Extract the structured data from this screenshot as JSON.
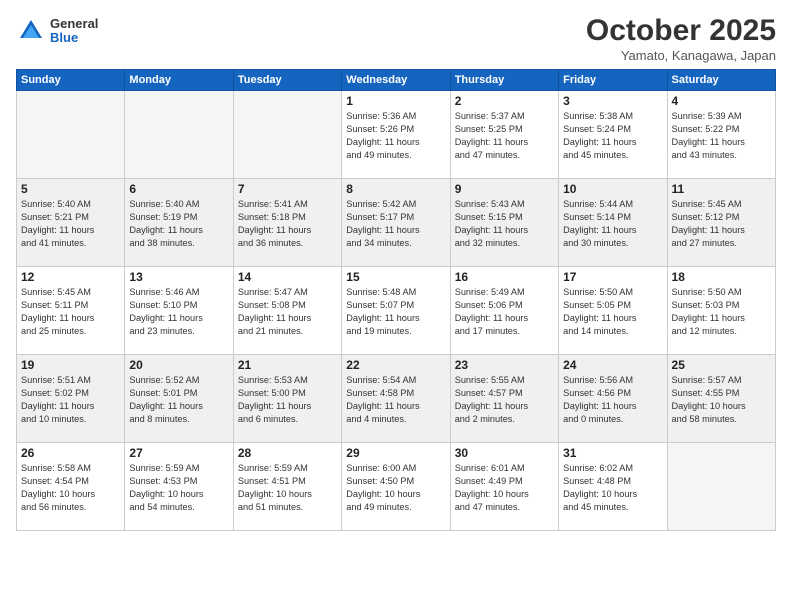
{
  "logo": {
    "general": "General",
    "blue": "Blue"
  },
  "title": "October 2025",
  "location": "Yamato, Kanagawa, Japan",
  "days_of_week": [
    "Sunday",
    "Monday",
    "Tuesday",
    "Wednesday",
    "Thursday",
    "Friday",
    "Saturday"
  ],
  "weeks": [
    {
      "shaded": false,
      "days": [
        {
          "date": "",
          "info": ""
        },
        {
          "date": "",
          "info": ""
        },
        {
          "date": "",
          "info": ""
        },
        {
          "date": "1",
          "info": "Sunrise: 5:36 AM\nSunset: 5:26 PM\nDaylight: 11 hours\nand 49 minutes."
        },
        {
          "date": "2",
          "info": "Sunrise: 5:37 AM\nSunset: 5:25 PM\nDaylight: 11 hours\nand 47 minutes."
        },
        {
          "date": "3",
          "info": "Sunrise: 5:38 AM\nSunset: 5:24 PM\nDaylight: 11 hours\nand 45 minutes."
        },
        {
          "date": "4",
          "info": "Sunrise: 5:39 AM\nSunset: 5:22 PM\nDaylight: 11 hours\nand 43 minutes."
        }
      ]
    },
    {
      "shaded": true,
      "days": [
        {
          "date": "5",
          "info": "Sunrise: 5:40 AM\nSunset: 5:21 PM\nDaylight: 11 hours\nand 41 minutes."
        },
        {
          "date": "6",
          "info": "Sunrise: 5:40 AM\nSunset: 5:19 PM\nDaylight: 11 hours\nand 38 minutes."
        },
        {
          "date": "7",
          "info": "Sunrise: 5:41 AM\nSunset: 5:18 PM\nDaylight: 11 hours\nand 36 minutes."
        },
        {
          "date": "8",
          "info": "Sunrise: 5:42 AM\nSunset: 5:17 PM\nDaylight: 11 hours\nand 34 minutes."
        },
        {
          "date": "9",
          "info": "Sunrise: 5:43 AM\nSunset: 5:15 PM\nDaylight: 11 hours\nand 32 minutes."
        },
        {
          "date": "10",
          "info": "Sunrise: 5:44 AM\nSunset: 5:14 PM\nDaylight: 11 hours\nand 30 minutes."
        },
        {
          "date": "11",
          "info": "Sunrise: 5:45 AM\nSunset: 5:12 PM\nDaylight: 11 hours\nand 27 minutes."
        }
      ]
    },
    {
      "shaded": false,
      "days": [
        {
          "date": "12",
          "info": "Sunrise: 5:45 AM\nSunset: 5:11 PM\nDaylight: 11 hours\nand 25 minutes."
        },
        {
          "date": "13",
          "info": "Sunrise: 5:46 AM\nSunset: 5:10 PM\nDaylight: 11 hours\nand 23 minutes."
        },
        {
          "date": "14",
          "info": "Sunrise: 5:47 AM\nSunset: 5:08 PM\nDaylight: 11 hours\nand 21 minutes."
        },
        {
          "date": "15",
          "info": "Sunrise: 5:48 AM\nSunset: 5:07 PM\nDaylight: 11 hours\nand 19 minutes."
        },
        {
          "date": "16",
          "info": "Sunrise: 5:49 AM\nSunset: 5:06 PM\nDaylight: 11 hours\nand 17 minutes."
        },
        {
          "date": "17",
          "info": "Sunrise: 5:50 AM\nSunset: 5:05 PM\nDaylight: 11 hours\nand 14 minutes."
        },
        {
          "date": "18",
          "info": "Sunrise: 5:50 AM\nSunset: 5:03 PM\nDaylight: 11 hours\nand 12 minutes."
        }
      ]
    },
    {
      "shaded": true,
      "days": [
        {
          "date": "19",
          "info": "Sunrise: 5:51 AM\nSunset: 5:02 PM\nDaylight: 11 hours\nand 10 minutes."
        },
        {
          "date": "20",
          "info": "Sunrise: 5:52 AM\nSunset: 5:01 PM\nDaylight: 11 hours\nand 8 minutes."
        },
        {
          "date": "21",
          "info": "Sunrise: 5:53 AM\nSunset: 5:00 PM\nDaylight: 11 hours\nand 6 minutes."
        },
        {
          "date": "22",
          "info": "Sunrise: 5:54 AM\nSunset: 4:58 PM\nDaylight: 11 hours\nand 4 minutes."
        },
        {
          "date": "23",
          "info": "Sunrise: 5:55 AM\nSunset: 4:57 PM\nDaylight: 11 hours\nand 2 minutes."
        },
        {
          "date": "24",
          "info": "Sunrise: 5:56 AM\nSunset: 4:56 PM\nDaylight: 11 hours\nand 0 minutes."
        },
        {
          "date": "25",
          "info": "Sunrise: 5:57 AM\nSunset: 4:55 PM\nDaylight: 10 hours\nand 58 minutes."
        }
      ]
    },
    {
      "shaded": false,
      "days": [
        {
          "date": "26",
          "info": "Sunrise: 5:58 AM\nSunset: 4:54 PM\nDaylight: 10 hours\nand 56 minutes."
        },
        {
          "date": "27",
          "info": "Sunrise: 5:59 AM\nSunset: 4:53 PM\nDaylight: 10 hours\nand 54 minutes."
        },
        {
          "date": "28",
          "info": "Sunrise: 5:59 AM\nSunset: 4:51 PM\nDaylight: 10 hours\nand 51 minutes."
        },
        {
          "date": "29",
          "info": "Sunrise: 6:00 AM\nSunset: 4:50 PM\nDaylight: 10 hours\nand 49 minutes."
        },
        {
          "date": "30",
          "info": "Sunrise: 6:01 AM\nSunset: 4:49 PM\nDaylight: 10 hours\nand 47 minutes."
        },
        {
          "date": "31",
          "info": "Sunrise: 6:02 AM\nSunset: 4:48 PM\nDaylight: 10 hours\nand 45 minutes."
        },
        {
          "date": "",
          "info": ""
        }
      ]
    }
  ]
}
